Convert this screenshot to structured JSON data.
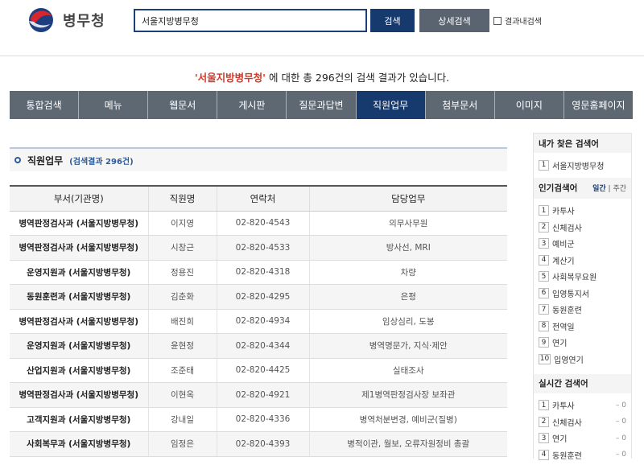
{
  "header": {
    "logo_text": "병무청",
    "search_value": "서울지방병무청",
    "search_button": "검색",
    "advanced_button": "상세검색",
    "within_results_label": "결과내검색"
  },
  "summary": {
    "keyword": "'서울지방병무청'",
    "text": " 에 대한 총 296건의 검색 결과가 있습니다."
  },
  "tabs": [
    {
      "label": "통합검색",
      "active": false
    },
    {
      "label": "메뉴",
      "active": false
    },
    {
      "label": "웹문서",
      "active": false
    },
    {
      "label": "게시판",
      "active": false
    },
    {
      "label": "질문과답변",
      "active": false
    },
    {
      "label": "직원업무",
      "active": true
    },
    {
      "label": "첨부문서",
      "active": false
    },
    {
      "label": "이미지",
      "active": false
    },
    {
      "label": "영문홈페이지",
      "active": false
    }
  ],
  "section": {
    "title": "직원업무",
    "count": "(검색결과 296건)"
  },
  "table": {
    "headers": [
      "부서(기관명)",
      "직원명",
      "연락처",
      "담당업무"
    ],
    "rows": [
      [
        "병역판정검사과 (서울지방병무청)",
        "이지영",
        "02-820-4543",
        "의무사무원"
      ],
      [
        "병역판정검사과 (서울지방병무청)",
        "시창근",
        "02-820-4533",
        "방사선, MRI"
      ],
      [
        "운영지원과 (서울지방병무청)",
        "정용진",
        "02-820-4318",
        "차량"
      ],
      [
        "동원훈련과 (서울지방병무청)",
        "김춘화",
        "02-820-4295",
        "은평"
      ],
      [
        "병역판정검사과 (서울지방병무청)",
        "배진희",
        "02-820-4934",
        "임상심리, 도봉"
      ],
      [
        "운영지원과 (서울지방병무청)",
        "윤현정",
        "02-820-4344",
        "병역명문가, 지식·제안"
      ],
      [
        "산업지원과 (서울지방병무청)",
        "조준태",
        "02-820-4425",
        "실태조사"
      ],
      [
        "병역판정검사과 (서울지방병무청)",
        "이현옥",
        "02-820-4921",
        "제1병역판정검사장 보좌관"
      ],
      [
        "고객지원과 (서울지방병무청)",
        "강내일",
        "02-820-4336",
        "병역처분변경, 예비군(질병)"
      ],
      [
        "사회복무과 (서울지방병무청)",
        "임정은",
        "02-820-4393",
        "병적이관, 월보, 오류자원정비 총괄"
      ]
    ]
  },
  "sidebar": {
    "my_searches_title": "내가 찾은 검색어",
    "my_searches": [
      {
        "num": "1",
        "term": "서울지방병무청"
      }
    ],
    "popular_title": "인기검색어",
    "popular_daily": "일간",
    "popular_weekly": "주간",
    "popular": [
      {
        "num": "1",
        "term": "카투사"
      },
      {
        "num": "2",
        "term": "신체검사"
      },
      {
        "num": "3",
        "term": "예비군"
      },
      {
        "num": "4",
        "term": "계산기"
      },
      {
        "num": "5",
        "term": "사회복무요원"
      },
      {
        "num": "6",
        "term": "입영통지서"
      },
      {
        "num": "7",
        "term": "동원훈련"
      },
      {
        "num": "8",
        "term": "전역일"
      },
      {
        "num": "9",
        "term": "연기"
      },
      {
        "num": "10",
        "term": "입영연기"
      }
    ],
    "realtime_title": "실시간 검색어",
    "realtime": [
      {
        "num": "1",
        "term": "카투사",
        "delta": "– 0"
      },
      {
        "num": "2",
        "term": "신체검사",
        "delta": "– 0"
      },
      {
        "num": "3",
        "term": "연기",
        "delta": "– 0"
      },
      {
        "num": "4",
        "term": "동원훈련",
        "delta": "– 0"
      }
    ]
  },
  "colors": {
    "accent_navy": "#173a6e",
    "tab_gray": "#5e6873",
    "keyword_red": "#d23a2a"
  }
}
